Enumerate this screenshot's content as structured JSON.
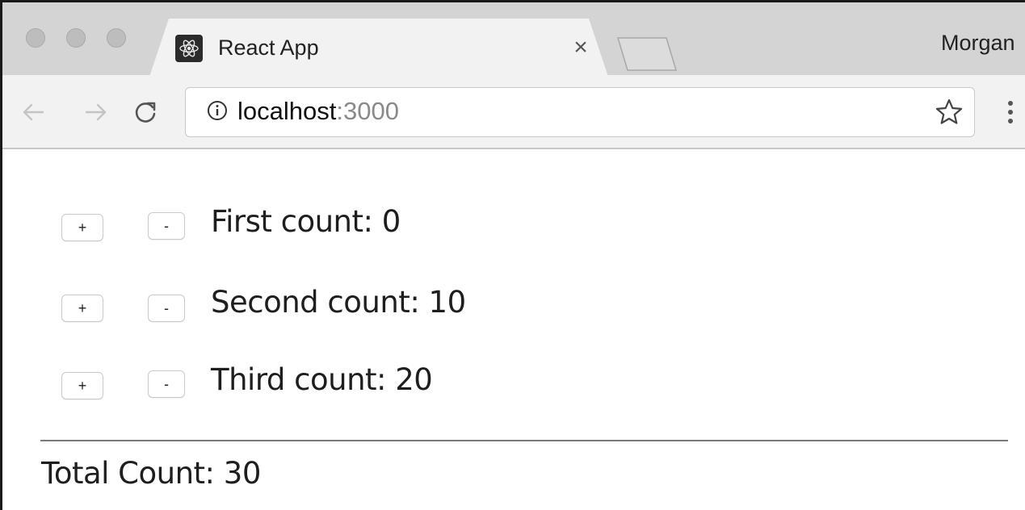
{
  "browser": {
    "tab": {
      "title": "React App",
      "close_glyph": "×",
      "favicon": "react-logo-icon"
    },
    "profile_name": "Morgan",
    "address": {
      "host": "localhost",
      "port": ":3000"
    },
    "icons": {
      "back": "back-arrow-icon",
      "forward": "forward-arrow-icon",
      "reload": "reload-icon",
      "info": "info-icon",
      "bookmark": "star-icon",
      "menu": "more-vertical-icon"
    }
  },
  "counters": [
    {
      "plus_label": "+",
      "minus_label": "-",
      "label": "First count: 0"
    },
    {
      "plus_label": "+",
      "minus_label": "-",
      "label": "Second count: 10"
    },
    {
      "plus_label": "+",
      "minus_label": "-",
      "label": "Third count: 20"
    }
  ],
  "total": "Total Count: 30"
}
